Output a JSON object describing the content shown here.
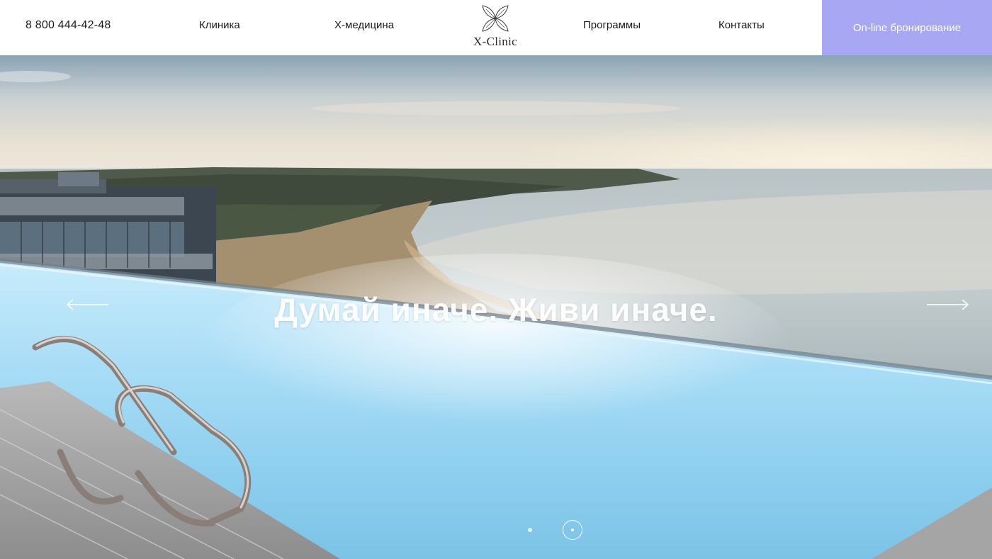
{
  "header": {
    "phone": "8 800 444-42-48",
    "nav": {
      "clinic": "Клиника",
      "x_medicine": "X-медицина",
      "programs": "Программы",
      "contacts": "Контакты"
    },
    "logo_text": "X-Clinic",
    "booking_button": "On-line бронирование"
  },
  "hero": {
    "slogan": "Думай иначе. Живи иначе.",
    "prev_icon": "arrow-left-icon",
    "next_icon": "arrow-right-icon",
    "slides_count": 2,
    "active_slide": 2
  },
  "colors": {
    "accent": "#a7a7f3",
    "text": "#1b1b1b",
    "header_bg": "#ffffff"
  }
}
